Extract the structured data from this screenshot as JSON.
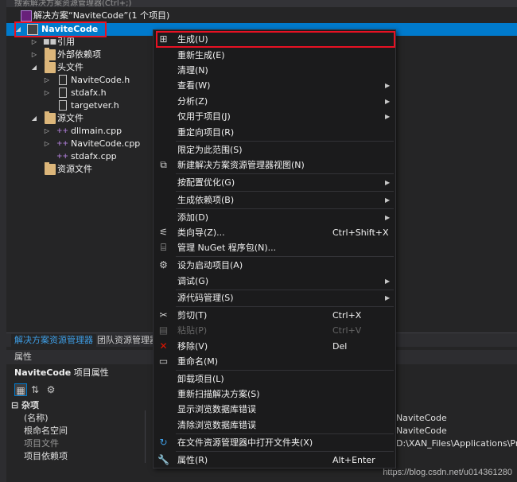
{
  "search": {
    "placeholder": "搜索解决方案资源管理器(Ctrl+;)"
  },
  "tree": {
    "solution_label": "解决方案“NaviteCode”(1 个项目)",
    "project_label": "NaviteCode",
    "items": [
      {
        "label": "引用"
      },
      {
        "label": "外部依赖项"
      },
      {
        "label": "头文件"
      },
      {
        "label": "NaviteCode.h"
      },
      {
        "label": "stdafx.h"
      },
      {
        "label": "targetver.h"
      },
      {
        "label": "源文件"
      },
      {
        "label": "dllmain.cpp"
      },
      {
        "label": "NaviteCode.cpp"
      },
      {
        "label": "stdafx.cpp"
      },
      {
        "label": "资源文件"
      }
    ]
  },
  "tabs": {
    "solution_explorer": "解决方案资源管理器",
    "team_explorer": "团队资源管理器"
  },
  "properties": {
    "title": "属性",
    "subject": "NaviteCode",
    "subject_suffix": "项目属性",
    "category": "杂项",
    "rows": [
      {
        "name": "(名称)",
        "value": "NaviteCode"
      },
      {
        "name": "根命名空间",
        "value": "NaviteCode"
      },
      {
        "name": "项目文件",
        "value": "D:\\XAN_Files\\Applications\\Proj"
      },
      {
        "name": "项目依赖项",
        "value": ""
      }
    ]
  },
  "context_menu": {
    "items": [
      {
        "label": "生成(U)",
        "icon": "build-icon"
      },
      {
        "label": "重新生成(E)"
      },
      {
        "label": "清理(N)"
      },
      {
        "label": "查看(W)",
        "submenu": true
      },
      {
        "label": "分析(Z)",
        "submenu": true
      },
      {
        "label": "仅用于项目(J)",
        "submenu": true
      },
      {
        "label": "重定向项目(R)"
      },
      {
        "label": "限定为此范围(S)"
      },
      {
        "label": "新建解决方案资源管理器视图(N)",
        "icon": "new-view-icon"
      },
      {
        "label": "按配置优化(G)",
        "submenu": true
      },
      {
        "label": "生成依赖项(B)",
        "submenu": true
      },
      {
        "label": "添加(D)",
        "submenu": true
      },
      {
        "label": "类向导(Z)...",
        "shortcut": "Ctrl+Shift+X",
        "icon": "class-wizard-icon"
      },
      {
        "label": "管理 NuGet 程序包(N)...",
        "icon": "nuget-icon"
      },
      {
        "label": "设为启动项目(A)",
        "icon": "gear-icon"
      },
      {
        "label": "调试(G)",
        "submenu": true
      },
      {
        "label": "源代码管理(S)",
        "submenu": true
      },
      {
        "label": "剪切(T)",
        "shortcut": "Ctrl+X",
        "icon": "scissors-icon"
      },
      {
        "label": "粘贴(P)",
        "shortcut": "Ctrl+V",
        "icon": "paste-icon",
        "disabled": true
      },
      {
        "label": "移除(V)",
        "shortcut": "Del",
        "icon": "remove-icon"
      },
      {
        "label": "重命名(M)",
        "icon": "rename-icon"
      },
      {
        "label": "卸载项目(L)"
      },
      {
        "label": "重新扫描解决方案(S)"
      },
      {
        "label": "显示浏览数据库错误"
      },
      {
        "label": "清除浏览数据库错误"
      },
      {
        "label": "在文件资源管理器中打开文件夹(X)",
        "icon": "refresh-arrow-icon"
      },
      {
        "label": "属性(R)",
        "shortcut": "Alt+Enter",
        "icon": "wrench-icon"
      }
    ]
  },
  "watermark": "https://blog.csdn.net/u014361280",
  "colors": {
    "accent": "#007acc",
    "highlight_box": "#e81123",
    "menu_bg": "#1b1b1c",
    "panel_bg": "#252526"
  }
}
